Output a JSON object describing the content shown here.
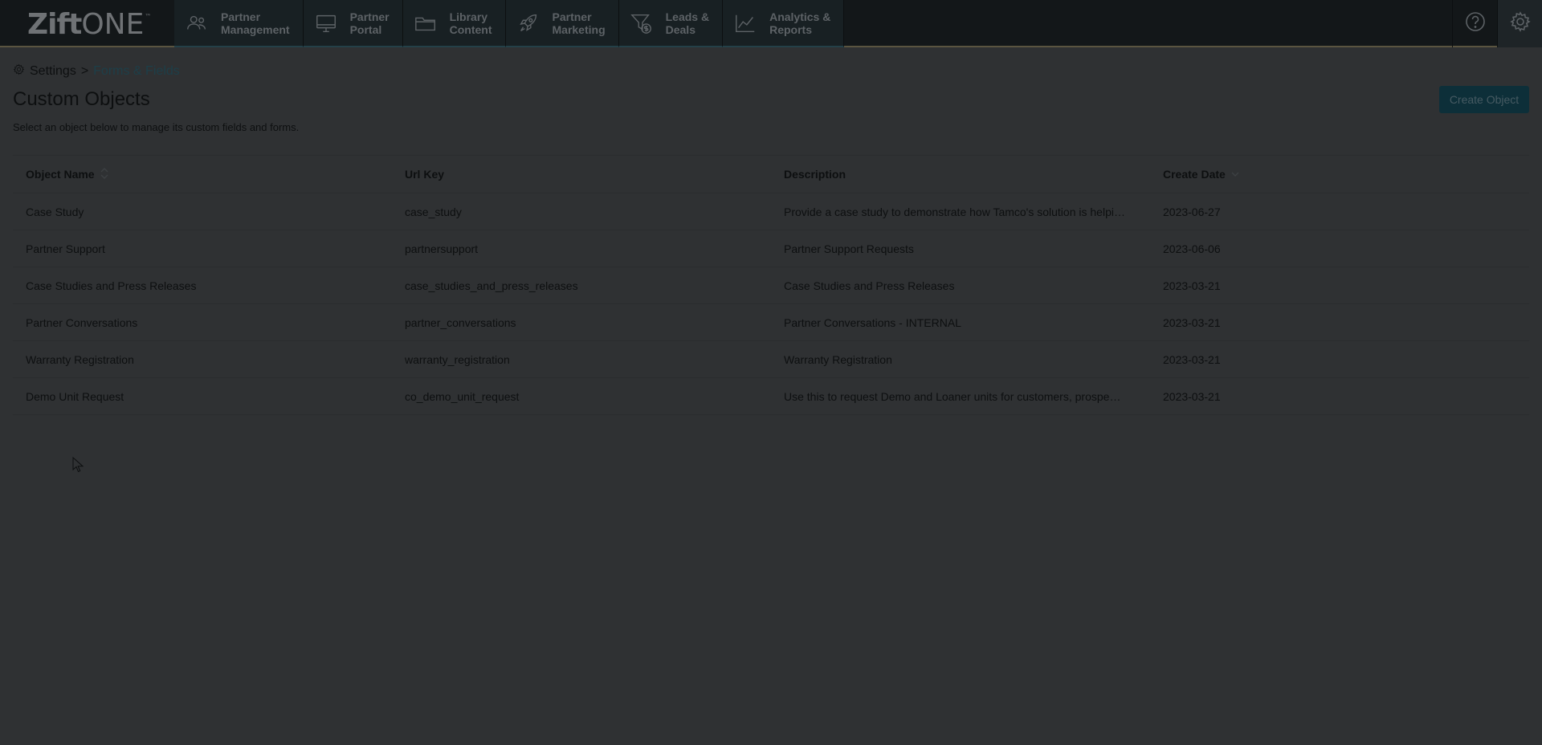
{
  "brand": {
    "logo_bold": "Zift",
    "logo_light": "ONE",
    "logo_tm": "™"
  },
  "nav": {
    "tabs": [
      {
        "label": "Partner\nManagement",
        "icon": "users-icon"
      },
      {
        "label": "Partner\nPortal",
        "icon": "monitor-icon"
      },
      {
        "label": "Library\nContent",
        "icon": "folder-icon"
      },
      {
        "label": "Partner\nMarketing",
        "icon": "rocket-icon"
      },
      {
        "label": "Leads &\nDeals",
        "icon": "funnel-dollar-icon"
      },
      {
        "label": "Analytics &\nReports",
        "icon": "line-chart-icon"
      }
    ],
    "help_icon": "help-icon",
    "settings_icon": "gear-icon"
  },
  "breadcrumb": {
    "root": "Settings",
    "separator": ">",
    "current": "Forms & Fields"
  },
  "page": {
    "title": "Custom Objects",
    "subtitle": "Select an object below to manage its custom fields and forms.",
    "create_button": "Create Object"
  },
  "table": {
    "columns": [
      "Object Name",
      "Url Key",
      "Description",
      "Create Date"
    ],
    "rows": [
      {
        "name": "Case Study",
        "url_key": "case_study",
        "description": "Provide a case study to demonstrate how Tamco's solution is helping y...",
        "date": "2023-06-27"
      },
      {
        "name": "Partner Support",
        "url_key": "partnersupport",
        "description": "Partner Support Requests",
        "date": "2023-06-06"
      },
      {
        "name": "Case Studies and Press Releases",
        "url_key": "case_studies_and_press_releases",
        "description": "Case Studies and Press Releases",
        "date": "2023-03-21"
      },
      {
        "name": "Partner Conversations",
        "url_key": "partner_conversations",
        "description": "Partner Conversations - INTERNAL",
        "date": "2023-03-21"
      },
      {
        "name": "Warranty Registration",
        "url_key": "warranty_registration",
        "description": "Warranty Registration",
        "date": "2023-03-21"
      },
      {
        "name": "Demo Unit Request",
        "url_key": "co_demo_unit_request",
        "description": "Use this to request Demo and Loaner units for customers, prospects, a...",
        "date": "2023-03-21"
      }
    ]
  },
  "colors": {
    "nav_background": "#131719",
    "page_background": "#2f3133",
    "accent": "#1d3f49",
    "button": "#0d2f39"
  }
}
